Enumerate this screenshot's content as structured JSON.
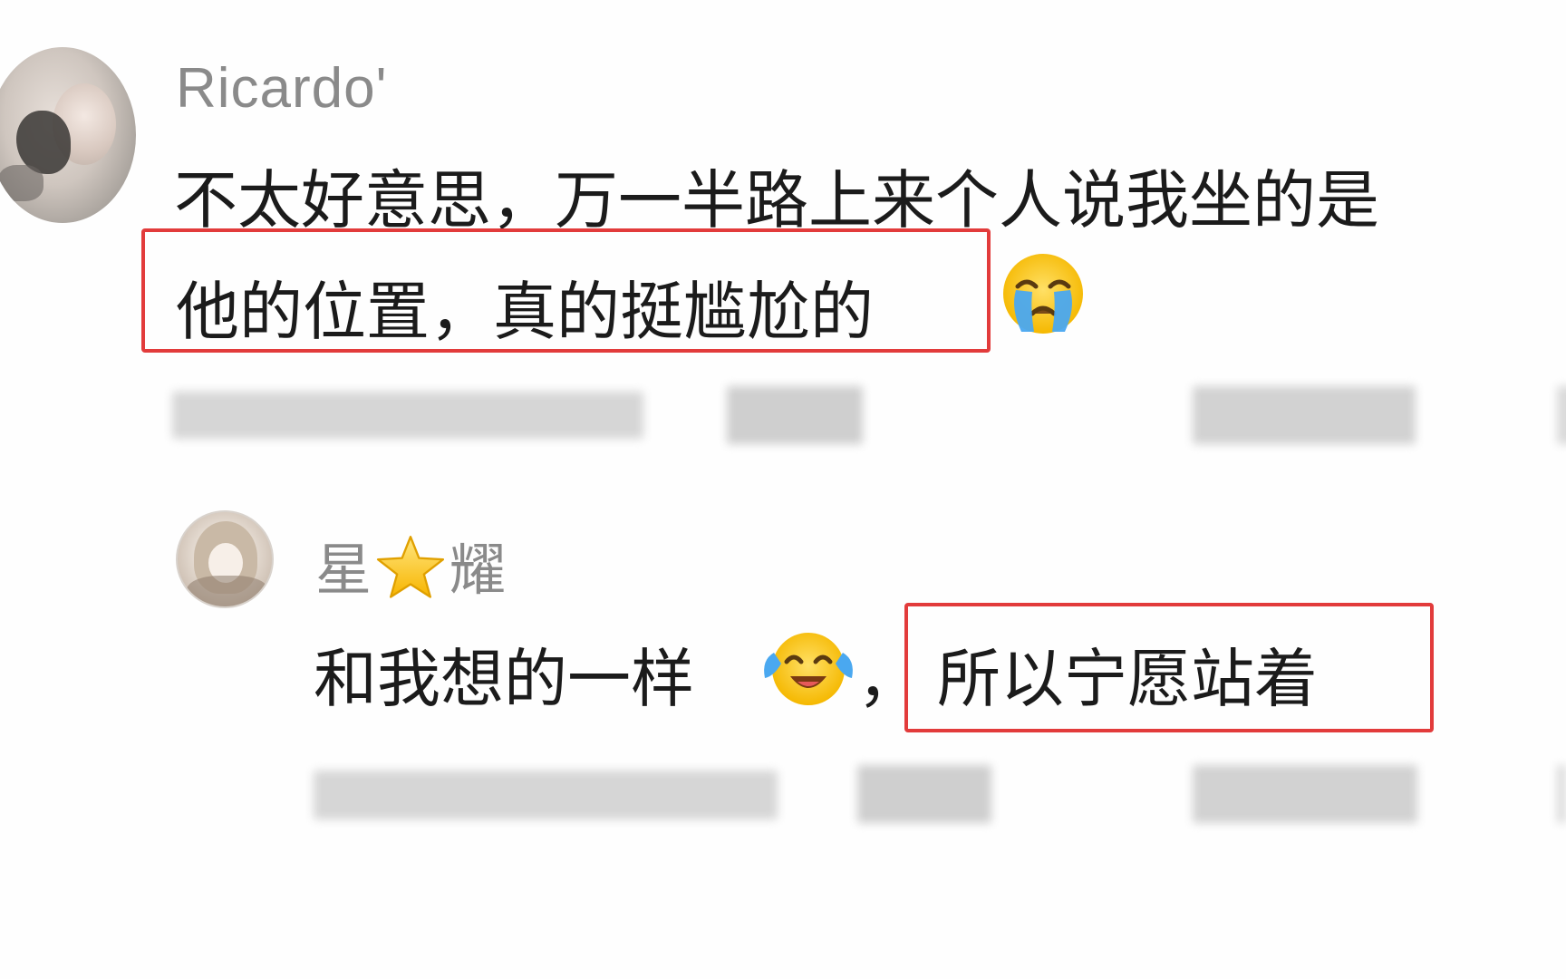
{
  "comment": {
    "username": "Ricardo'",
    "text_line1": "不太好意思，万一半路上来个人说我坐的是",
    "text_line2": "他的位置，真的挺尴尬的",
    "emoji": "loudly-crying-face"
  },
  "reply": {
    "username_left": "星",
    "username_right": "耀",
    "username_emoji": "star",
    "text_part1": "和我想的一样",
    "emoji": "face-with-tears-of-joy",
    "comma": "，",
    "text_part2": "所以宁愿站着"
  },
  "colors": {
    "highlight_border": "#e23b3b",
    "username": "#8a8a8a",
    "text": "#1b1b1b",
    "background": "#fefefe"
  }
}
